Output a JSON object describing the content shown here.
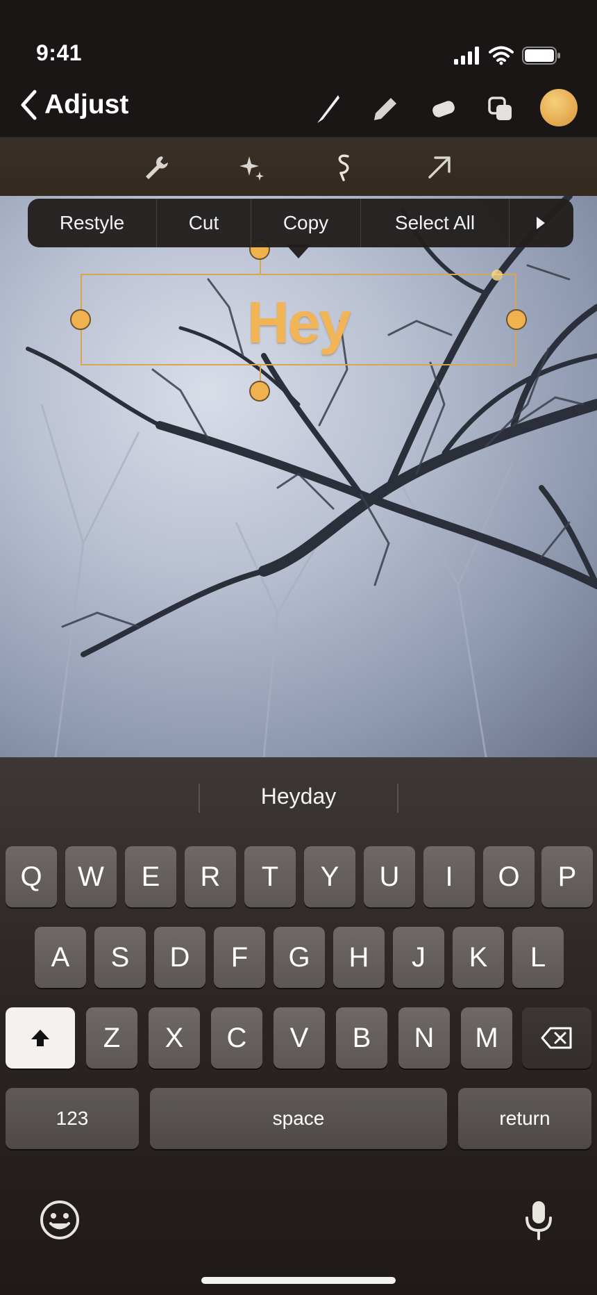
{
  "status_bar": {
    "time": "9:41"
  },
  "nav": {
    "back_label": "Adjust",
    "tools": [
      "pen-icon",
      "marker-icon",
      "eraser-icon",
      "layers-icon"
    ],
    "accent_color": "#e8ac4f"
  },
  "sub_toolbar": {
    "tools": [
      "wrench-icon",
      "sparkle-icon",
      "lasso-icon",
      "arrow-icon"
    ]
  },
  "canvas": {
    "text_layer": "Hey",
    "text_color": "#f1b456"
  },
  "context_menu": {
    "items": [
      "Restyle",
      "Cut",
      "Copy",
      "Select All"
    ],
    "more_icon": "triangle-right-icon"
  },
  "keyboard": {
    "suggestion": "Heyday",
    "row1": [
      "Q",
      "W",
      "E",
      "R",
      "T",
      "Y",
      "U",
      "I",
      "O",
      "P"
    ],
    "row2": [
      "A",
      "S",
      "D",
      "F",
      "G",
      "H",
      "J",
      "K",
      "L"
    ],
    "row3": [
      "Z",
      "X",
      "C",
      "V",
      "B",
      "N",
      "M"
    ],
    "numbers_label": "123",
    "space_label": "space",
    "return_label": "return"
  }
}
